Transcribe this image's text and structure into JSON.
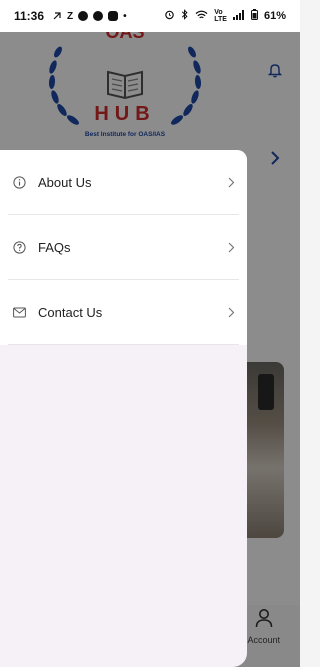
{
  "status_bar": {
    "time": "11:36",
    "left_icons": [
      "missed-call-icon",
      "z-icon",
      "app-badge-icon",
      "whatsapp-icon",
      "app-icon",
      "dot-icon"
    ],
    "battery": "61%"
  },
  "header": {
    "logo_text_top": "OAS",
    "logo_text_bottom": "HUB",
    "logo_tagline": "Best Institute for OAS/IAS"
  },
  "drawer": {
    "items": [
      {
        "label": "About Us",
        "icon": "info-icon"
      },
      {
        "label": "FAQs",
        "icon": "help-icon"
      },
      {
        "label": "Contact Us",
        "icon": "mail-icon"
      }
    ]
  },
  "bottom_nav": {
    "account_label": "Account"
  },
  "colors": {
    "scrim": "#000000",
    "drawer_bg": "#f6f1f6",
    "menu_bg": "#ffffff",
    "logo_blue": "#1f4aa8",
    "logo_red": "#d12b2b"
  }
}
